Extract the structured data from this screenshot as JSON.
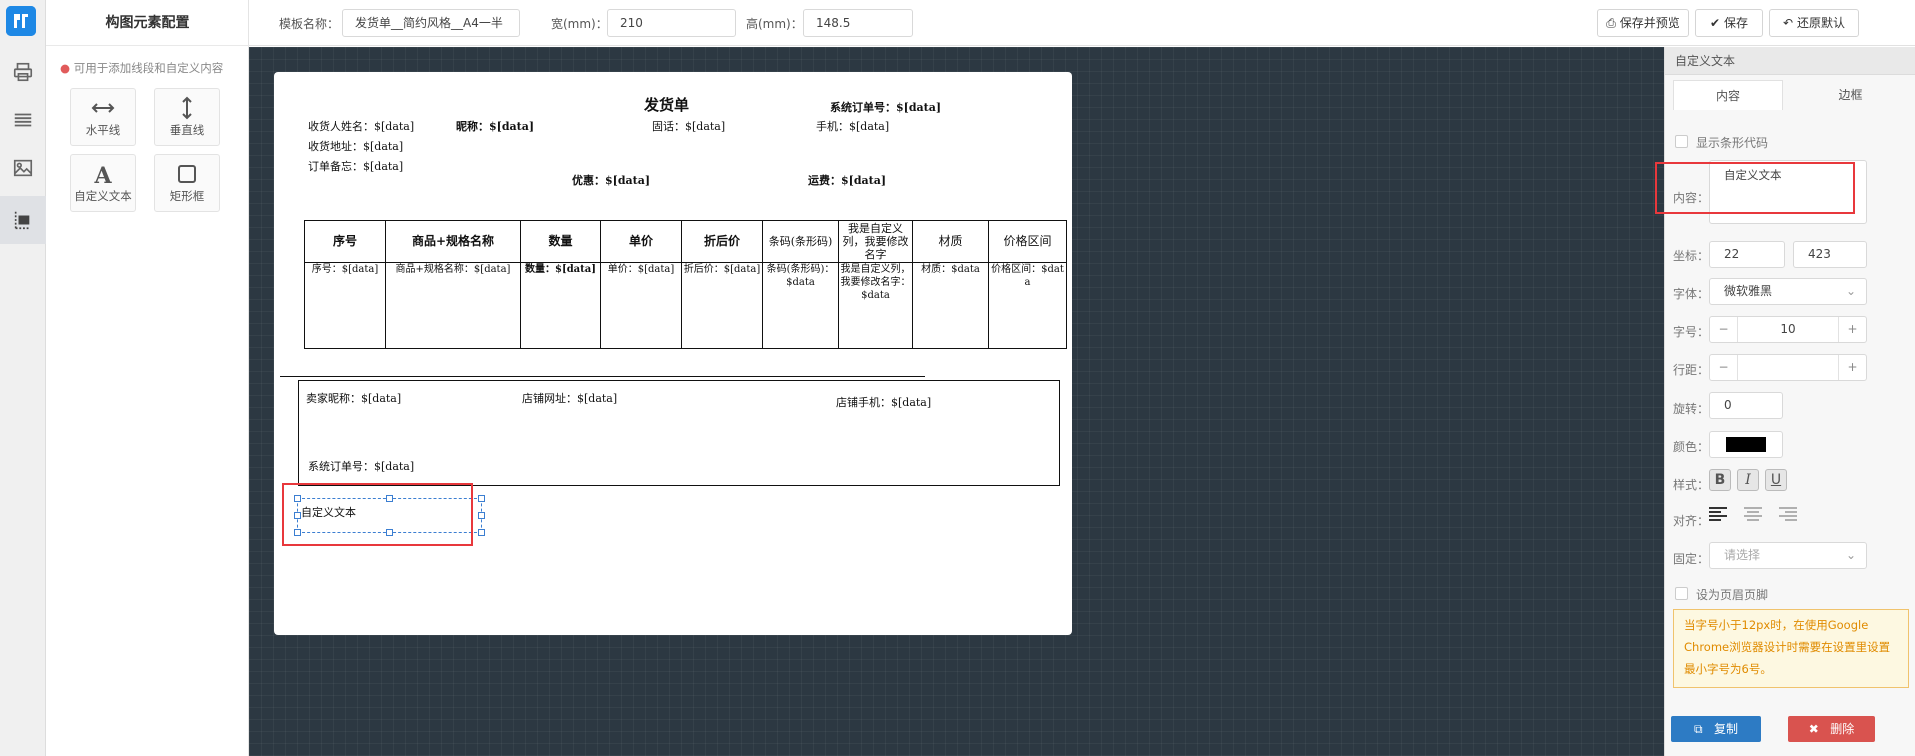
{
  "app": {
    "logo": "logo-icon",
    "rail_icons": [
      "printer-icon",
      "list-icon",
      "image-icon",
      "layout-icon"
    ]
  },
  "elements_panel": {
    "title": "构图元素配置",
    "hint": "可用于添加线段和自定义内容",
    "tools": [
      {
        "label": "水平线",
        "icon": "horizontal-arrow-icon"
      },
      {
        "label": "垂直线",
        "icon": "vertical-arrow-icon"
      },
      {
        "label": "自定义文本",
        "icon": "text-icon"
      },
      {
        "label": "矩形框",
        "icon": "rectangle-icon"
      }
    ]
  },
  "toolbar": {
    "template_label": "模板名称：",
    "template_value": "发货单__简约风格__A4一半",
    "width_label": "宽(mm)：",
    "width_value": "210",
    "height_label": "高(mm)：",
    "height_value": "148.5",
    "save_preview": "保存并预览",
    "save": "保存",
    "reset": "还原默认"
  },
  "paper": {
    "title": "发货单",
    "order_no": "系统订单号：$[data]",
    "receiver_name": "收货人姓名：$[data]",
    "nickname": "昵称：$[data]",
    "phone": "固话：$[data]",
    "mobile": "手机：$[data]",
    "address": "收货地址：$[data]",
    "remark": "订单备忘：$[data]",
    "discount": "优惠：$[data]",
    "shipping": "运费：$[data]",
    "table": {
      "headers": [
        "序号",
        "商品+规格名称",
        "数量",
        "单价",
        "折后价",
        "条码(条形码)",
        "我是自定义列，我要修改名字",
        "材质",
        "价格区间"
      ],
      "row": [
        "序号：$[data]",
        "商品+规格名称：$[data]",
        "数量：$[data]",
        "单价：$[data]",
        "折后价：$[data]",
        "条码(条形码)：$data",
        "我是自定义列，我要修改名字：$data",
        "材质：$data",
        "价格区间：$data"
      ]
    },
    "seller_nick": "卖家昵称：$[data]",
    "shop_url": "店铺网址：$[data]",
    "shop_phone": "店铺手机：$[data]",
    "footer_order_no": "系统订单号：$[data]",
    "custom_text": "自定义文本"
  },
  "props": {
    "header": "自定义文本",
    "tabs": [
      "内容",
      "边框"
    ],
    "show_barcode_code": "显示条形代码",
    "content_label": "内容：",
    "content_value": "自定义文本",
    "coord_label": "坐标：",
    "coord_x": "22",
    "coord_y": "423",
    "font_label": "字体：",
    "font_value": "微软雅黑",
    "size_label": "字号：",
    "size_value": "10",
    "line_label": "行距：",
    "line_value": "",
    "rotate_label": "旋转：",
    "rotate_value": "0",
    "color_label": "颜色：",
    "color_value": "#000000",
    "style_label": "样式：",
    "style_bold": "B",
    "style_italic": "I",
    "style_underline": "U",
    "align_label": "对齐：",
    "fixed_label": "固定：",
    "fixed_placeholder": "请选择",
    "header_footer": "设为页眉页脚",
    "note": "当字号小于12px时，在使用Google Chrome浏览器设计时需要在设置里设置最小字号为6号。",
    "copy": "复制",
    "delete": "删除",
    "minus": "−",
    "plus": "+"
  }
}
